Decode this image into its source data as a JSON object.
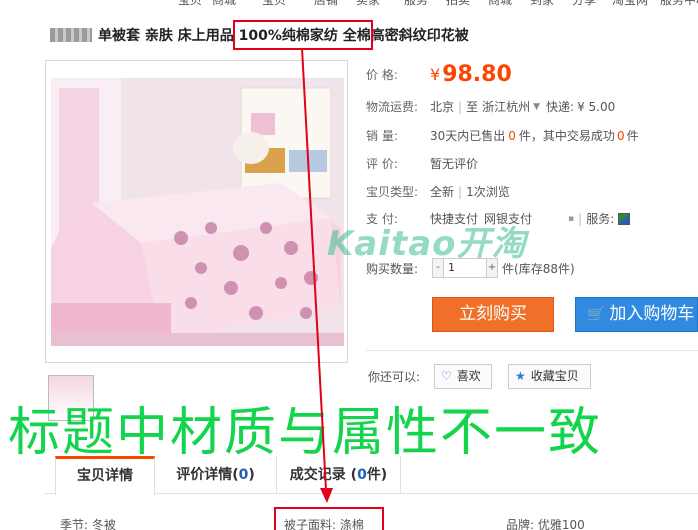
{
  "top_nav": [
    "宝贝",
    "商城",
    "宝贝",
    "店铺",
    "卖家",
    "服务",
    "拍卖",
    "商城",
    "到家",
    "分享",
    "淘宝网",
    "服务中心"
  ],
  "title": {
    "text": "单被套 亲肤 床上用品 100%纯棉家纺 全棉高密斜纹印花被",
    "highlight": "100%纯棉家纺"
  },
  "product": {
    "price_label": "价    格:",
    "price_symbol": "¥",
    "price": "98.80",
    "shipping_label": "物流运费:",
    "ship_from": "北京",
    "ship_to_prefix": "至",
    "ship_to": "浙江杭州",
    "express_label": "快递:",
    "express_fee": "¥ 5.00",
    "sales_label": "销    量:",
    "sales_prefix": "30天内已售出",
    "sold_count": "0",
    "sales_mid": "件，其中交易成功",
    "success_count": "0",
    "sales_suffix": "件",
    "rating_label": "评    价:",
    "rating_value": "暂无评价",
    "type_label": "宝贝类型:",
    "type_value": "全新",
    "views": "1次浏览",
    "pay_label": "支    付:",
    "pay_methods": [
      "快捷支付",
      "网银支付"
    ],
    "service_label": "服务:"
  },
  "watermark": "Kaitao开淘",
  "quantity": {
    "label": "购买数量:",
    "minus": "-",
    "value": "1",
    "plus": "+",
    "unit": "件",
    "stock": "(库存88件)"
  },
  "buttons": {
    "buy_now": "立刻购买",
    "add_to_cart": "加入购物车",
    "also_label": "你还可以:",
    "like": "喜欢",
    "favorite": "收藏宝贝"
  },
  "annotation": "标题中材质与属性不一致",
  "tabs": [
    {
      "label": "宝贝详情",
      "count": ""
    },
    {
      "label": "评价详情",
      "count": "0"
    },
    {
      "label": "成交记录",
      "count": "0"
    }
  ],
  "attributes": [
    {
      "text": "季节: 冬被"
    },
    {
      "text": "被子面料: 涤棉"
    },
    {
      "text": "品牌: 优雅100"
    }
  ],
  "colors": {
    "price": "#ff4400",
    "buy": "#f0702a",
    "cart": "#2f8ae0",
    "annotation": "#13d44d",
    "highlight_box": "#e2001a"
  }
}
